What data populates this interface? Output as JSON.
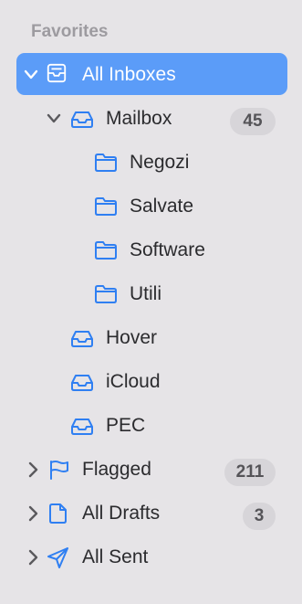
{
  "sidebar": {
    "section_title": "Favorites",
    "items": [
      {
        "label": "All Inboxes",
        "icon": "inbox-tray-icon",
        "selected": true
      },
      {
        "label": "Mailbox",
        "icon": "inbox-icon",
        "badge": "45"
      },
      {
        "label": "Negozi",
        "icon": "folder-icon"
      },
      {
        "label": "Salvate",
        "icon": "folder-icon"
      },
      {
        "label": "Software",
        "icon": "folder-icon"
      },
      {
        "label": "Utili",
        "icon": "folder-icon"
      },
      {
        "label": "Hover",
        "icon": "inbox-icon"
      },
      {
        "label": "iCloud",
        "icon": "inbox-icon"
      },
      {
        "label": "PEC",
        "icon": "inbox-icon"
      },
      {
        "label": "Flagged",
        "icon": "flag-icon",
        "badge": "211"
      },
      {
        "label": "All Drafts",
        "icon": "document-icon",
        "badge": "3"
      },
      {
        "label": "All Sent",
        "icon": "paper-plane-icon"
      }
    ]
  },
  "colors": {
    "accent_blue": "#2f7ff2",
    "selection_bg": "#5b9cf8",
    "sidebar_bg": "#e6e4e7",
    "badge_bg": "#d7d5d9"
  }
}
